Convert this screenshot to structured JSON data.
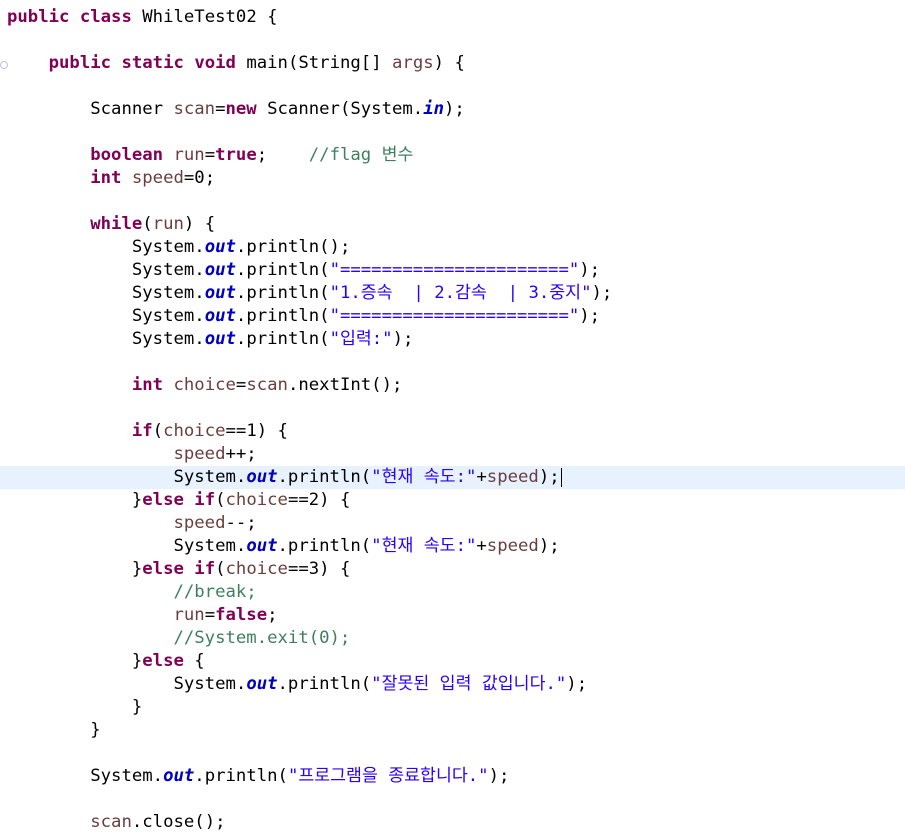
{
  "editor": {
    "language": "java",
    "colors": {
      "keyword": "#7f0055",
      "local_variable": "#6a3e3e",
      "static_field": "#0000c0",
      "string": "#2a00ff",
      "comment": "#3f7f5f",
      "current_line": "#e8f2fe"
    },
    "current_line_index": 20,
    "lines": [
      {
        "indent": "",
        "tokens": [
          {
            "t": "public",
            "c": "kw"
          },
          {
            "t": " "
          },
          {
            "t": "class",
            "c": "kw"
          },
          {
            "t": " WhileTest02 {"
          }
        ]
      },
      {
        "indent": "",
        "tokens": []
      },
      {
        "indent": "    ",
        "tokens": [
          {
            "t": "public",
            "c": "kw"
          },
          {
            "t": " "
          },
          {
            "t": "static",
            "c": "kw"
          },
          {
            "t": " "
          },
          {
            "t": "void",
            "c": "kw"
          },
          {
            "t": " main(String[] "
          },
          {
            "t": "args",
            "c": "var"
          },
          {
            "t": ") {"
          }
        ]
      },
      {
        "indent": "",
        "tokens": []
      },
      {
        "indent": "        ",
        "tokens": [
          {
            "t": "Scanner "
          },
          {
            "t": "scan",
            "c": "var"
          },
          {
            "t": "="
          },
          {
            "t": "new",
            "c": "kw"
          },
          {
            "t": " Scanner(System."
          },
          {
            "t": "in",
            "c": "field"
          },
          {
            "t": ");"
          }
        ]
      },
      {
        "indent": "",
        "tokens": []
      },
      {
        "indent": "        ",
        "tokens": [
          {
            "t": "boolean",
            "c": "kw"
          },
          {
            "t": " "
          },
          {
            "t": "run",
            "c": "var"
          },
          {
            "t": "="
          },
          {
            "t": "true",
            "c": "kw"
          },
          {
            "t": ";    "
          },
          {
            "t": "//flag ",
            "c": "cmt"
          },
          {
            "t": "변수",
            "c": "cmt",
            "kr": true
          }
        ]
      },
      {
        "indent": "        ",
        "tokens": [
          {
            "t": "int",
            "c": "kw"
          },
          {
            "t": " "
          },
          {
            "t": "speed",
            "c": "var"
          },
          {
            "t": "=0;"
          }
        ]
      },
      {
        "indent": "",
        "tokens": []
      },
      {
        "indent": "        ",
        "tokens": [
          {
            "t": "while",
            "c": "kw"
          },
          {
            "t": "("
          },
          {
            "t": "run",
            "c": "var"
          },
          {
            "t": ") {"
          }
        ]
      },
      {
        "indent": "            ",
        "tokens": [
          {
            "t": "System."
          },
          {
            "t": "out",
            "c": "field"
          },
          {
            "t": ".println();"
          }
        ]
      },
      {
        "indent": "            ",
        "tokens": [
          {
            "t": "System."
          },
          {
            "t": "out",
            "c": "field"
          },
          {
            "t": ".println("
          },
          {
            "t": "\"======================\"",
            "c": "str"
          },
          {
            "t": ");"
          }
        ]
      },
      {
        "indent": "            ",
        "tokens": [
          {
            "t": "System."
          },
          {
            "t": "out",
            "c": "field"
          },
          {
            "t": ".println("
          },
          {
            "t": "\"1.",
            "c": "str"
          },
          {
            "t": "증속",
            "c": "str",
            "kr": true
          },
          {
            "t": "  | 2.",
            "c": "str"
          },
          {
            "t": "감속",
            "c": "str",
            "kr": true
          },
          {
            "t": "  | 3.",
            "c": "str"
          },
          {
            "t": "중지",
            "c": "str",
            "kr": true
          },
          {
            "t": "\"",
            "c": "str"
          },
          {
            "t": ");"
          }
        ]
      },
      {
        "indent": "            ",
        "tokens": [
          {
            "t": "System."
          },
          {
            "t": "out",
            "c": "field"
          },
          {
            "t": ".println("
          },
          {
            "t": "\"======================\"",
            "c": "str"
          },
          {
            "t": ");"
          }
        ]
      },
      {
        "indent": "            ",
        "tokens": [
          {
            "t": "System."
          },
          {
            "t": "out",
            "c": "field"
          },
          {
            "t": ".println("
          },
          {
            "t": "\"",
            "c": "str"
          },
          {
            "t": "입력",
            "c": "str",
            "kr": true
          },
          {
            "t": ":\"",
            "c": "str"
          },
          {
            "t": ");"
          }
        ]
      },
      {
        "indent": "",
        "tokens": []
      },
      {
        "indent": "            ",
        "tokens": [
          {
            "t": "int",
            "c": "kw"
          },
          {
            "t": " "
          },
          {
            "t": "choice",
            "c": "var"
          },
          {
            "t": "="
          },
          {
            "t": "scan",
            "c": "var"
          },
          {
            "t": ".nextInt();"
          }
        ]
      },
      {
        "indent": "",
        "tokens": []
      },
      {
        "indent": "            ",
        "tokens": [
          {
            "t": "if",
            "c": "kw"
          },
          {
            "t": "("
          },
          {
            "t": "choice",
            "c": "var"
          },
          {
            "t": "==1) {"
          }
        ]
      },
      {
        "indent": "                ",
        "tokens": [
          {
            "t": "speed",
            "c": "var"
          },
          {
            "t": "++;"
          }
        ]
      },
      {
        "indent": "                ",
        "tokens": [
          {
            "t": "System."
          },
          {
            "t": "out",
            "c": "field"
          },
          {
            "t": ".println("
          },
          {
            "t": "\"",
            "c": "str"
          },
          {
            "t": "현재 속도",
            "c": "str",
            "kr": true
          },
          {
            "t": ":\"",
            "c": "str"
          },
          {
            "t": "+"
          },
          {
            "t": "speed",
            "c": "var"
          },
          {
            "t": ");"
          }
        ],
        "caret": true
      },
      {
        "indent": "            ",
        "tokens": [
          {
            "t": "}"
          },
          {
            "t": "else",
            "c": "kw"
          },
          {
            "t": " "
          },
          {
            "t": "if",
            "c": "kw"
          },
          {
            "t": "("
          },
          {
            "t": "choice",
            "c": "var"
          },
          {
            "t": "==2) {"
          }
        ]
      },
      {
        "indent": "                ",
        "tokens": [
          {
            "t": "speed",
            "c": "var"
          },
          {
            "t": "--;"
          }
        ]
      },
      {
        "indent": "                ",
        "tokens": [
          {
            "t": "System."
          },
          {
            "t": "out",
            "c": "field"
          },
          {
            "t": ".println("
          },
          {
            "t": "\"",
            "c": "str"
          },
          {
            "t": "현재 속도",
            "c": "str",
            "kr": true
          },
          {
            "t": ":\"",
            "c": "str"
          },
          {
            "t": "+"
          },
          {
            "t": "speed",
            "c": "var"
          },
          {
            "t": ");"
          }
        ]
      },
      {
        "indent": "            ",
        "tokens": [
          {
            "t": "}"
          },
          {
            "t": "else",
            "c": "kw"
          },
          {
            "t": " "
          },
          {
            "t": "if",
            "c": "kw"
          },
          {
            "t": "("
          },
          {
            "t": "choice",
            "c": "var"
          },
          {
            "t": "==3) {"
          }
        ]
      },
      {
        "indent": "                ",
        "tokens": [
          {
            "t": "//break;",
            "c": "cmt"
          }
        ]
      },
      {
        "indent": "                ",
        "tokens": [
          {
            "t": "run",
            "c": "var"
          },
          {
            "t": "="
          },
          {
            "t": "false",
            "c": "kw"
          },
          {
            "t": ";"
          }
        ]
      },
      {
        "indent": "                ",
        "tokens": [
          {
            "t": "//System.exit(0);",
            "c": "cmt"
          }
        ]
      },
      {
        "indent": "            ",
        "tokens": [
          {
            "t": "}"
          },
          {
            "t": "else",
            "c": "kw"
          },
          {
            "t": " {"
          }
        ]
      },
      {
        "indent": "                ",
        "tokens": [
          {
            "t": "System."
          },
          {
            "t": "out",
            "c": "field"
          },
          {
            "t": ".println("
          },
          {
            "t": "\"",
            "c": "str"
          },
          {
            "t": "잘못된 입력 값입니다",
            "c": "str",
            "kr": true
          },
          {
            "t": ".\"",
            "c": "str"
          },
          {
            "t": ");"
          }
        ]
      },
      {
        "indent": "            ",
        "tokens": [
          {
            "t": "}"
          }
        ]
      },
      {
        "indent": "        ",
        "tokens": [
          {
            "t": "}"
          }
        ]
      },
      {
        "indent": "",
        "tokens": []
      },
      {
        "indent": "        ",
        "tokens": [
          {
            "t": "System."
          },
          {
            "t": "out",
            "c": "field"
          },
          {
            "t": ".println("
          },
          {
            "t": "\"",
            "c": "str"
          },
          {
            "t": "프로그램을 종료합니다",
            "c": "str",
            "kr": true
          },
          {
            "t": ".\"",
            "c": "str"
          },
          {
            "t": ");"
          }
        ]
      },
      {
        "indent": "",
        "tokens": []
      },
      {
        "indent": "        ",
        "tokens": [
          {
            "t": "scan",
            "c": "var"
          },
          {
            "t": ".close();"
          }
        ]
      }
    ]
  }
}
